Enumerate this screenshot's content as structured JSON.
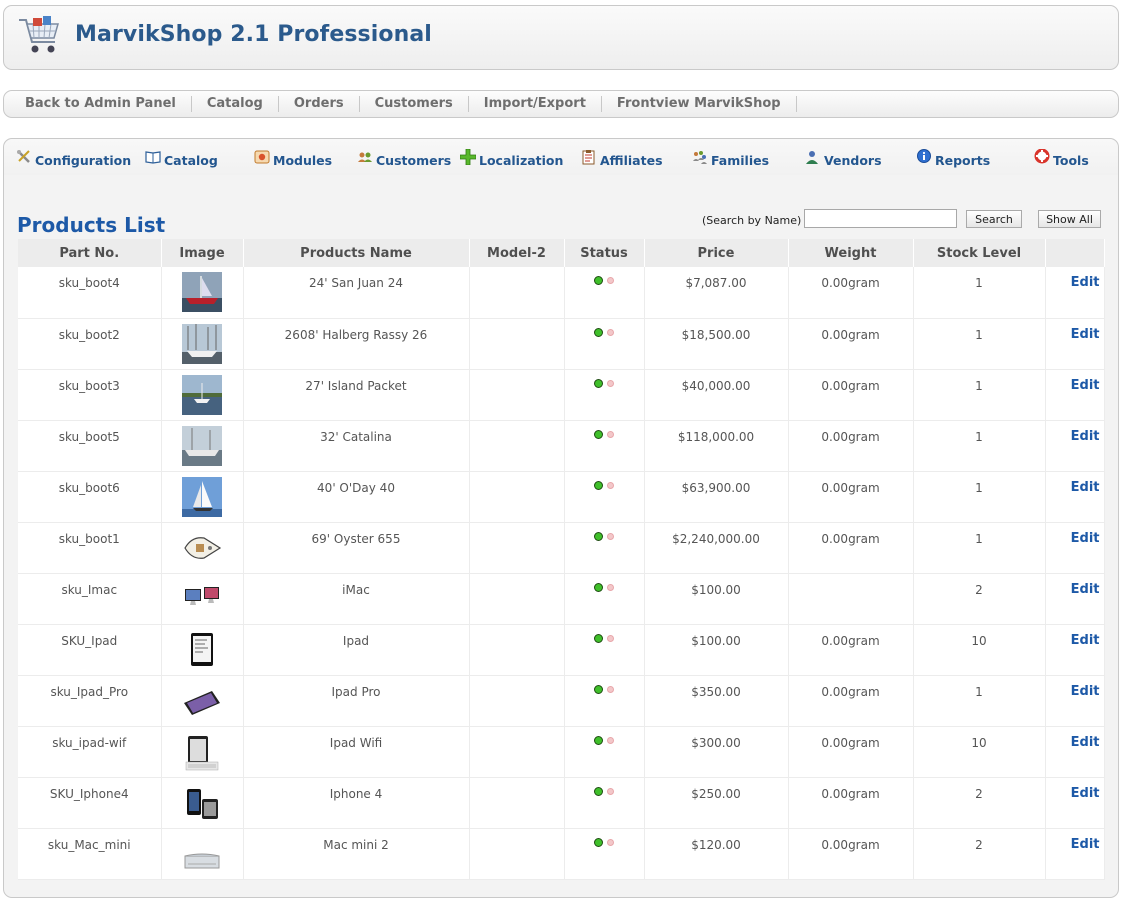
{
  "app": {
    "title": "MarvikShop 2.1 Professional"
  },
  "topnav": [
    {
      "label": "Back to Admin Panel"
    },
    {
      "label": "Catalog"
    },
    {
      "label": "Orders"
    },
    {
      "label": "Customers"
    },
    {
      "label": "Import/Export"
    },
    {
      "label": "Frontview MarvikShop"
    }
  ],
  "toolbar": [
    {
      "label": "Configuration",
      "icon": "tools-icon"
    },
    {
      "label": "Catalog",
      "icon": "book-icon"
    },
    {
      "label": "Modules",
      "icon": "modules-icon"
    },
    {
      "label": "Customers",
      "icon": "users-icon"
    },
    {
      "label": "Localization",
      "icon": "plus-icon"
    },
    {
      "label": "Affiliates",
      "icon": "clipboard-icon"
    },
    {
      "label": "Families",
      "icon": "family-icon"
    },
    {
      "label": "Vendors",
      "icon": "vendor-icon"
    },
    {
      "label": "Reports",
      "icon": "info-icon"
    },
    {
      "label": "Tools",
      "icon": "lifebuoy-icon"
    }
  ],
  "page": {
    "heading": "Products List"
  },
  "search": {
    "label": "(Search by Name)",
    "value": "",
    "button": "Search",
    "show_all": "Show All"
  },
  "table": {
    "headers": [
      "Part No.",
      "Image",
      "Products Name",
      "Model-2",
      "Status",
      "Price",
      "Weight",
      "Stock Level",
      ""
    ],
    "edit_label": "Edit",
    "rows": [
      {
        "part": "sku_boot4",
        "image": "boat-red",
        "name": "24' San Juan 24",
        "model": "",
        "price": "$7,087.00",
        "weight": "0.00gram",
        "stock": "1"
      },
      {
        "part": "sku_boot2",
        "image": "boat-harbor",
        "name": "2608' Halberg Rassy 26",
        "model": "",
        "price": "$18,500.00",
        "weight": "0.00gram",
        "stock": "1"
      },
      {
        "part": "sku_boot3",
        "image": "boat-lake",
        "name": "27' Island Packet",
        "model": "",
        "price": "$40,000.00",
        "weight": "0.00gram",
        "stock": "1"
      },
      {
        "part": "sku_boot5",
        "image": "boat-dock",
        "name": "32' Catalina",
        "model": "",
        "price": "$118,000.00",
        "weight": "0.00gram",
        "stock": "1"
      },
      {
        "part": "sku_boot6",
        "image": "sailboat",
        "name": "40' O'Day 40",
        "model": "",
        "price": "$63,900.00",
        "weight": "0.00gram",
        "stock": "1"
      },
      {
        "part": "sku_boot1",
        "image": "yacht-plan",
        "name": "69' Oyster 655",
        "model": "",
        "price": "$2,240,000.00",
        "weight": "0.00gram",
        "stock": "1"
      },
      {
        "part": "sku_Imac",
        "image": "imac",
        "name": "iMac",
        "model": "",
        "price": "$100.00",
        "weight": "",
        "stock": "2"
      },
      {
        "part": "SKU_Ipad",
        "image": "ipad",
        "name": "Ipad",
        "model": "",
        "price": "$100.00",
        "weight": "0.00gram",
        "stock": "10"
      },
      {
        "part": "sku_Ipad_Pro",
        "image": "ipad-pro",
        "name": "Ipad Pro",
        "model": "",
        "price": "$350.00",
        "weight": "0.00gram",
        "stock": "1"
      },
      {
        "part": "sku_ipad-wif",
        "image": "ipad-wifi",
        "name": "Ipad Wifi",
        "model": "",
        "price": "$300.00",
        "weight": "0.00gram",
        "stock": "10"
      },
      {
        "part": "SKU_Iphone4",
        "image": "iphone",
        "name": "Iphone 4",
        "model": "",
        "price": "$250.00",
        "weight": "0.00gram",
        "stock": "2"
      },
      {
        "part": "sku_Mac_mini",
        "image": "mac-mini",
        "name": "Mac mini 2",
        "model": "",
        "price": "$120.00",
        "weight": "0.00gram",
        "stock": "2"
      }
    ]
  }
}
